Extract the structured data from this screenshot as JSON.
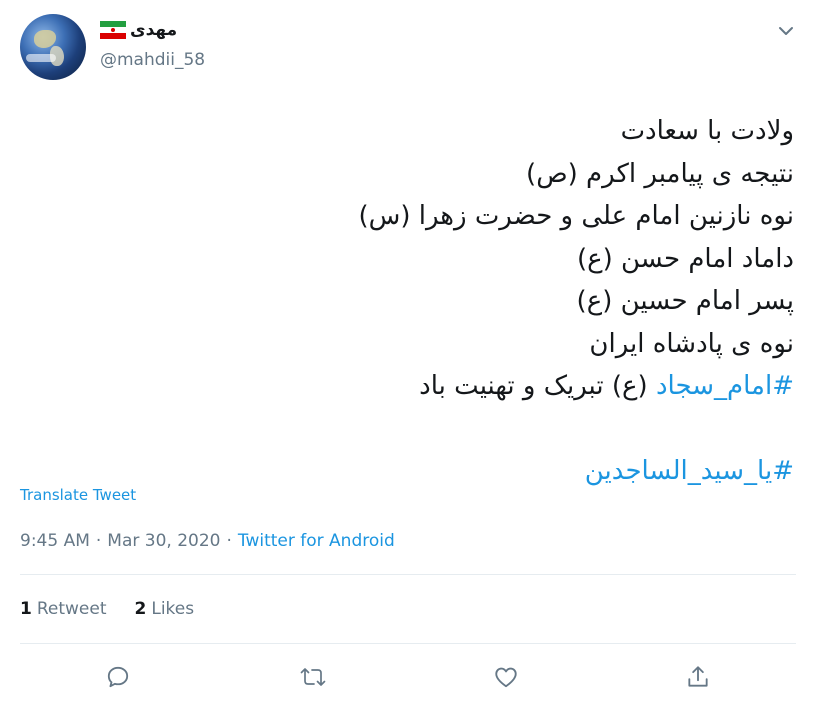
{
  "user": {
    "display_name": "مهدی",
    "flag_icon": "iran-flag-icon",
    "handle": "@mahdii_58"
  },
  "tweet": {
    "lines": [
      "ولادت با سعادت",
      "نتیجه ی پیامبر اکرم (ص)",
      "نوه نازنین امام علی و حضرت زهرا (س)",
      "داماد امام حسن (ع)",
      "پسر امام حسین (ع)",
      "نوه ی پادشاه ایران"
    ],
    "line7_hashtag": "#امام_سجاد",
    "line7_rest": " (ع) تبریک و تهنیت باد",
    "hashtag2": "#یا_سید_الساجدین"
  },
  "translate_label": "Translate Tweet",
  "meta": {
    "time": "9:45 AM",
    "sep1": "·",
    "date": "Mar 30, 2020",
    "sep2": "·",
    "source": "Twitter for Android"
  },
  "stats": {
    "retweets_count": "1",
    "retweets_label": "Retweet",
    "likes_count": "2",
    "likes_label": "Likes"
  },
  "actions": [
    "reply-icon",
    "retweet-icon",
    "like-icon",
    "share-icon"
  ],
  "colors": {
    "accent": "#1b95e0",
    "muted": "#657786",
    "text": "#14171a"
  }
}
